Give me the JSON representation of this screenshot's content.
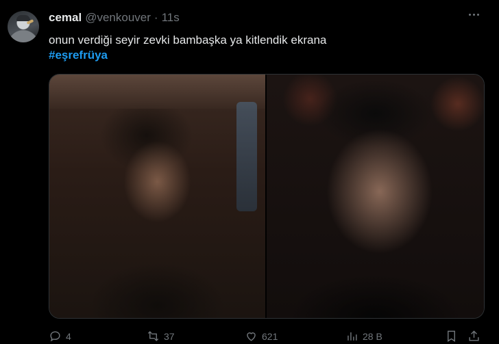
{
  "tweet": {
    "display_name": "cemal",
    "handle": "@venkouver",
    "separator": "·",
    "time": "11s",
    "text": "onun verdiği seyir zevki bambaşka ya kitlendik ekrana",
    "hashtag": "#eşrefrüya",
    "media": [
      {
        "icon": "photo"
      },
      {
        "icon": "photo"
      }
    ]
  },
  "actions": {
    "replies": "4",
    "reposts": "37",
    "likes": "621",
    "views": "28 B"
  },
  "colors": {
    "background": "#000000",
    "primary_text": "#e7e9ea",
    "secondary_text": "#71767b",
    "link": "#1d9bf0",
    "border": "#2f3336"
  }
}
